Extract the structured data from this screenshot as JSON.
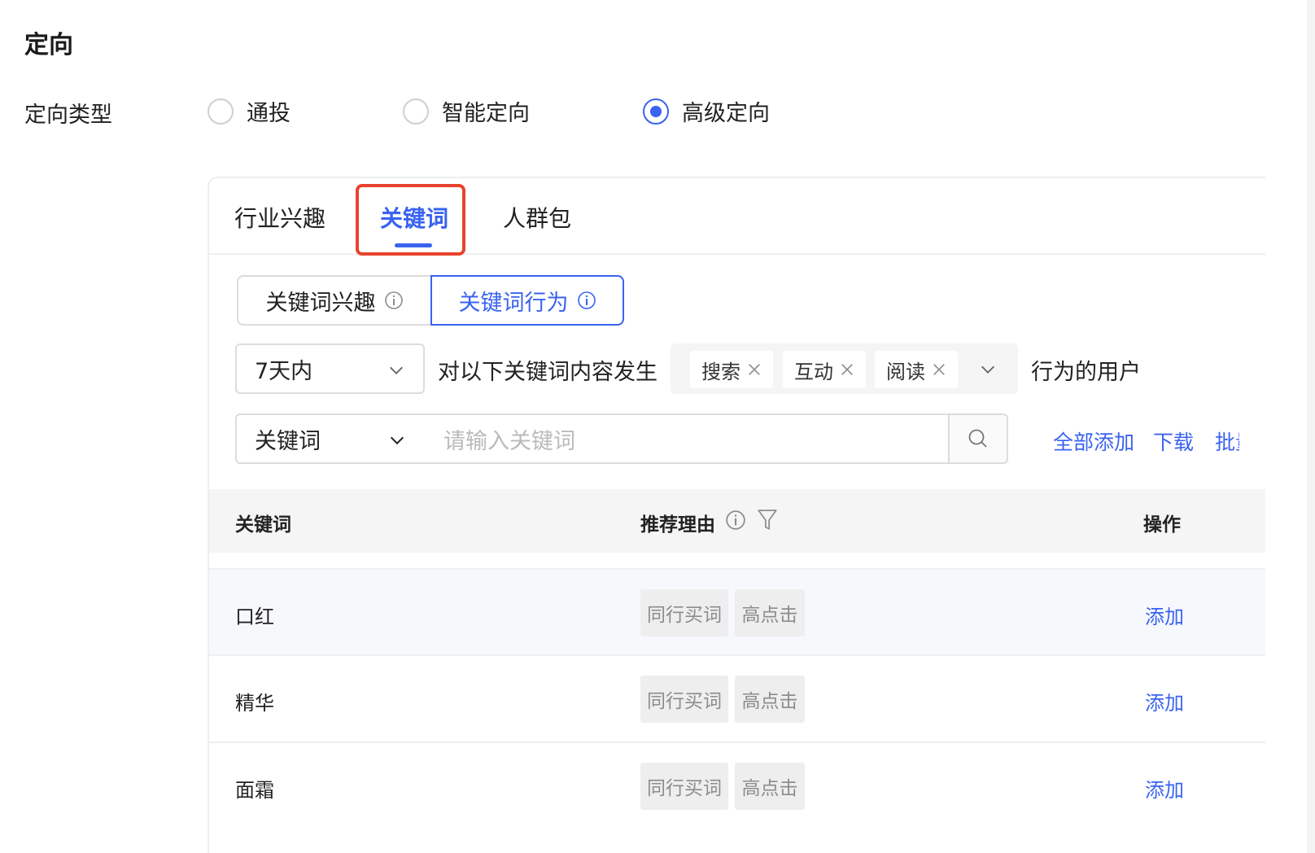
{
  "section_title": "定向",
  "targeting_type": {
    "label": "定向类型",
    "options": [
      "通投",
      "智能定向",
      "高级定向"
    ],
    "selected": "高级定向"
  },
  "tabs": {
    "items": [
      "行业兴趣",
      "关键词",
      "人群包"
    ],
    "active": "关键词"
  },
  "segment": {
    "items": [
      "关键词兴趣",
      "关键词行为"
    ],
    "active": "关键词行为"
  },
  "behavior": {
    "period": "7天内",
    "text_before": "对以下关键词内容发生",
    "tags": [
      "搜索",
      "互动",
      "阅读"
    ],
    "text_after": "行为的用户"
  },
  "search": {
    "type": "关键词",
    "placeholder": "请输入关键词",
    "links": [
      "全部添加",
      "下载",
      "批量"
    ]
  },
  "table": {
    "headers": [
      "关键词",
      "推荐理由",
      "操作"
    ],
    "rows": [
      {
        "keyword": "口红",
        "reasons": [
          "同行买词",
          "高点击"
        ],
        "action": "添加"
      },
      {
        "keyword": "精华",
        "reasons": [
          "同行买词",
          "高点击"
        ],
        "action": "添加"
      },
      {
        "keyword": "面霜",
        "reasons": [
          "同行买词",
          "高点击"
        ],
        "action": "添加"
      }
    ]
  },
  "colors": {
    "primary": "#3a63f0",
    "highlight": "#e8432e",
    "tag_bg": "#eeeeee"
  }
}
